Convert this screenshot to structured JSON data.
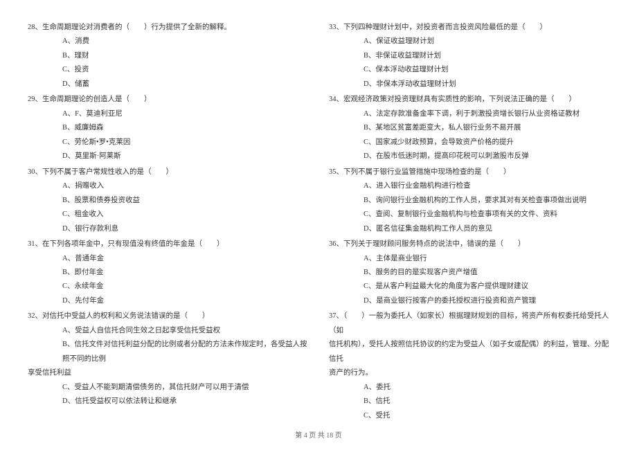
{
  "left": {
    "q28": {
      "text": "28、生命周期理论对消费者的（　　）行为提供了全新的解释。",
      "a": "A、消费",
      "b": "B、理财",
      "c": "C、投资",
      "d": "D、储蓄"
    },
    "q29": {
      "text": "29、生命周期理论的创造人是（　　）",
      "a": "A、F、莫迪利亚尼",
      "b": "B、威廉姆森",
      "c": "C、劳伦斯•罗•克莱因",
      "d": "D、莫里斯·阿莱斯"
    },
    "q30": {
      "text": "30、下列不属于客户常规性收入的是（　　）",
      "a": "A、捐赠收入",
      "b": "B、股票和债券投资收益",
      "c": "C、租金收入",
      "d": "D、银行存款利息"
    },
    "q31": {
      "text": "31、在下列各项年金中，只有现值没有终值的年金是（　　）",
      "a": "A、普通年金",
      "b": "B、即付年金",
      "c": "C、永续年金",
      "d": "D、先付年金"
    },
    "q32": {
      "text": "32、对信托中受益人的权利和义务说法错误的是（　　）",
      "a": "A、受益人自信托合同生效之日起享受信托受益权",
      "b": "B、信托文件对信托利益分配的比例或者分配的方法未作规定时，各受益人按照不同的比例",
      "b_cont": "享受信托利益",
      "c": "C、受益人不能到期清偿债务的，其信托财产可以用于清偿",
      "d": "D、信托受益权可以依法转让和继承"
    }
  },
  "right": {
    "q33": {
      "text": "33、下列四种理财计划中，对投资者而言投资风险最低的是（　　）",
      "a": "A、保证收益理财计划",
      "b": "B、非保证收益理财计划",
      "c": "C、保本浮动收益理财计划",
      "d": "D、非保本浮动收益理财计划"
    },
    "q34": {
      "text": "34、宏观经济政策对投资理财具有实质性的影响，下列说法正确的是（　　）",
      "a": "A、法定存款准备金率下调，利于刺激投资增长银行从业资格证教材",
      "b": "B、某地区贫富差距变大，私人银行业务不易开展",
      "c": "C、国家减少财政预算，会导致资产价格的提升",
      "d": "D、在股市低迷时期，提高印花税可以刺激股市反弹"
    },
    "q35": {
      "text": "35、下列不属于银行业监管措施中现场检查的是（　　）",
      "a": "A、进入银行业金融机构进行检查",
      "b": "B、询问银行业金融机构的工作人员，要求其对有关检查事项做出说明",
      "c": "C、查阅、复制银行业金融机构与检查事项有关的文件、资料",
      "d": "D、匿名信征集金融机构工作人员的意见"
    },
    "q36": {
      "text": "36、下列关于理财顾问服务特点的说法中，错误的是（　　）",
      "a": "A、主体是商业银行",
      "b": "B、服务的目的是实现客户资产增值",
      "c": "C、是从客户利益最大化的角度为客户提供理财建议",
      "d": "D、是商业银行按客户的委托授权进行投资和资产管理"
    },
    "q37": {
      "text": "37、（　　）一般为委托人（如家长）根据理财规划的目标，将资产所有权委托给受托人（如",
      "cont1": "信托机构），受托人按照信托协议的约定为受益人（如子女或配偶）的利益，管理、分配信托",
      "cont2": "资产的行为。",
      "a": "A、委托",
      "b": "B、信托",
      "c": "C、受托"
    }
  },
  "footer": "第 4 页 共 18 页"
}
